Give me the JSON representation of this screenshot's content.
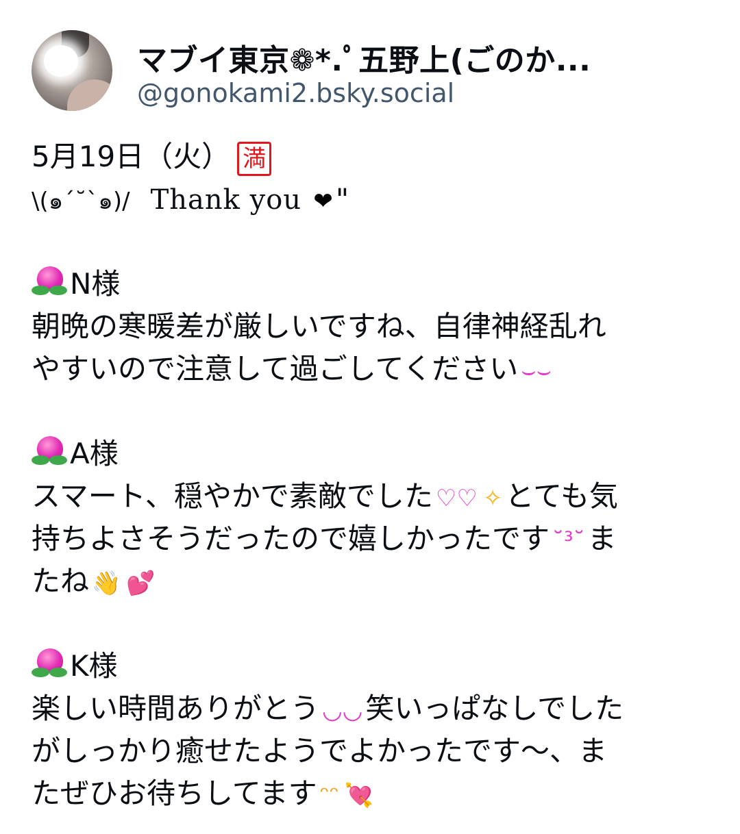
{
  "author": {
    "display_name": "マブイ東京❁*.ﾟ五野上(ごのか...",
    "handle": "@gonokami2.bsky.social"
  },
  "post": {
    "date_line": "5月19日（火）",
    "full_badge": "満",
    "kaomoji": "\\(๑´˘`๑)/",
    "thanks_text": "Thank you",
    "heart_after_thanks": "❤",
    "quote_mark": "\"",
    "sections": [
      {
        "name": "N様",
        "lines": [
          "朝晩の寒暖差が厳しいですね、自律神経乱れ",
          "やすいので注意して過ごしてください"
        ],
        "trailing_emoji": "⌣⌣"
      },
      {
        "name": "A様",
        "line1_a": "スマート、穏やかで素敵でした",
        "line1_emoji1": "♡♡",
        "line1_emoji2": "✧",
        "line1_b": "とても気",
        "line2_a": "持ちよさそうだったので嬉しかったです",
        "line2_emoji": "˘³˘",
        "line2_b": "ま",
        "line3_a": "たね",
        "line3_emoji1": "👋",
        "line3_emoji2": "💕"
      },
      {
        "name": "K様",
        "line1_a": "楽しい時間ありがとう",
        "line1_emoji": "◡◡",
        "line1_b": "笑いっぱなしでした",
        "line2": "がしっかり癒せたようでよかったです〜、ま",
        "line3_a": "たぜひお待ちしてます",
        "line3_emoji1": "ᵔᵔ",
        "line3_emoji2": "💘"
      }
    ]
  },
  "colors": {
    "text": "#0b0f14",
    "handle": "#42576c",
    "peach": "#e22bb6",
    "leaf": "#3fa84a",
    "badge": "#e3161d"
  },
  "icons": {
    "peach": "peach-icon",
    "full_badge": "full-badge-icon"
  }
}
